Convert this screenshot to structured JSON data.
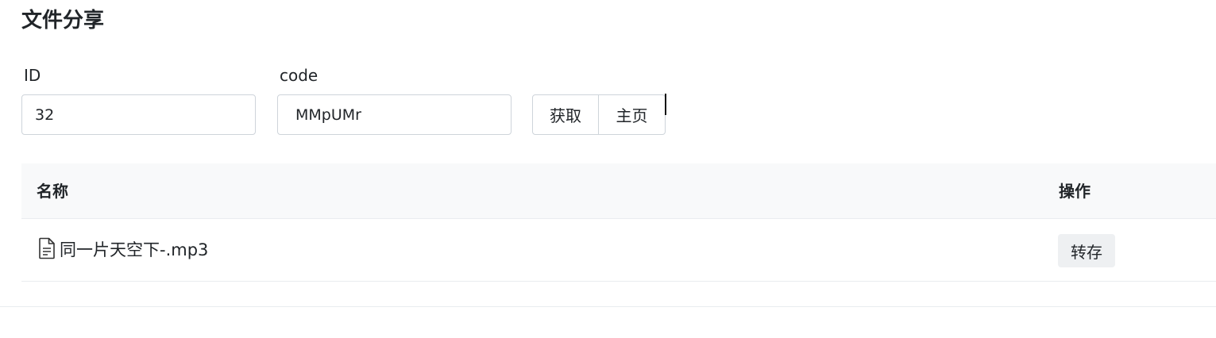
{
  "page": {
    "title": "文件分享"
  },
  "form": {
    "id_label": "ID",
    "id_value": "32",
    "code_label": "code",
    "code_value": "MMpUMr",
    "fetch_button": "获取",
    "home_button": "主页"
  },
  "table": {
    "headers": {
      "name": "名称",
      "action": "操作"
    },
    "rows": [
      {
        "icon": "file-text-icon",
        "name": "同一片天空下-.mp3",
        "action_label": "转存"
      }
    ]
  }
}
